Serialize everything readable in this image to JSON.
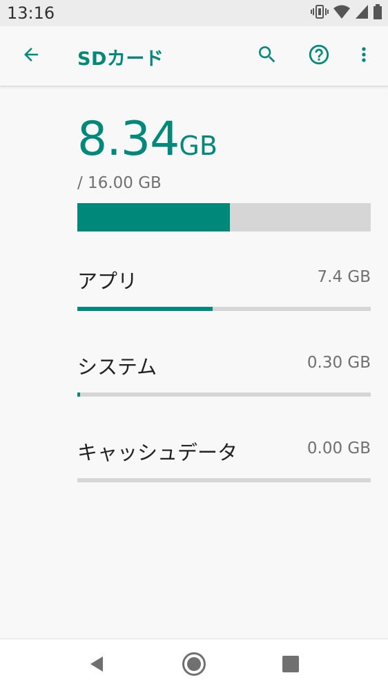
{
  "status_bar": {
    "time": "13:16",
    "icons": [
      "vibrate-icon",
      "wifi-icon",
      "signal-icon",
      "battery-icon"
    ]
  },
  "app_bar": {
    "title": "SDカード",
    "actions": [
      "back-arrow-icon",
      "search-icon",
      "help-icon",
      "more-vert-icon"
    ],
    "accent_color": "#00897b"
  },
  "storage": {
    "used_value": "8.34",
    "used_unit": "GB",
    "total_text": "/ 16.00 GB",
    "used_fraction": 0.521
  },
  "categories": [
    {
      "label": "アプリ",
      "value": "7.4 GB",
      "fraction": 0.46
    },
    {
      "label": "システム",
      "value": "0.30 GB",
      "fraction": 0.01
    },
    {
      "label": "キャッシュデータ",
      "value": "0.00 GB",
      "fraction": 0.0
    }
  ],
  "nav_bar": {
    "buttons": [
      "back-triangle-icon",
      "home-circle-icon",
      "recents-square-icon"
    ]
  }
}
